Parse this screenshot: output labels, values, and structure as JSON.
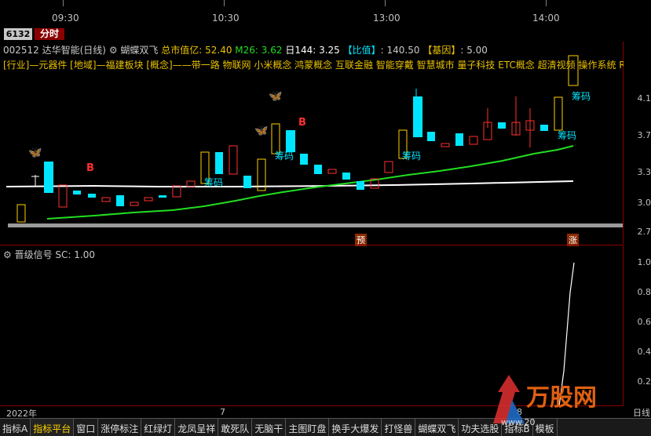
{
  "time_axis": {
    "labels": [
      "09:30",
      "10:30",
      "13:00",
      "14:00"
    ]
  },
  "toolbar": {
    "code_tag": "6132",
    "tab_label": "分时"
  },
  "header": {
    "stock_line": "002512 达华智能(日线)",
    "indicator_name": "蝴蝶双飞",
    "market_cap": "总市值亿: 52.40",
    "m26": "M26: 3.62",
    "d144": "日144: 3.25",
    "ratio_label": "【比值】",
    "ratio_value": ": 140.50",
    "gene_label": "【基因】",
    "gene_value": ": 5.00"
  },
  "concepts": "[行业]—元器件 [地域]—福建板块 [概念]——带一路 物联网 小米概念 鸿蒙概念 互联金融 智能穿戴 智慧城市 量子科技 ETC概念 超清视频 操作系统 RCS",
  "price_axis": [
    "4.1",
    "3.7",
    "3.3",
    "3.0",
    "2.7"
  ],
  "low_label": "",
  "signals": {
    "b1": "B",
    "b2": "B",
    "chip1": "筹码",
    "chip2": "筹码",
    "chip3": "筹码",
    "chip4": "筹码",
    "chip5": "筹码",
    "tag_yu": "预",
    "tag_zhang": "涨"
  },
  "sub_panel": {
    "title": "晋级信号",
    "sc": "SC: 1.00",
    "axis": [
      "1.0",
      "0.8",
      "0.6",
      "0.4",
      "0.2"
    ]
  },
  "bottom_axis": {
    "year": "2022年",
    "m7": "7",
    "m8": "8"
  },
  "tabs": [
    "指标A",
    "指标平台",
    "窗口",
    "涨停标注",
    "红绿灯",
    "龙凤呈祥",
    "敢死队",
    "无脑干",
    "主图盯盘",
    "换手大爆发",
    "打怪兽",
    "蝴蝶双飞",
    "功夫选股",
    "指标B",
    "模板"
  ],
  "right_corner": "日线",
  "watermark": {
    "brand": "万股网",
    "url": "www.20"
  },
  "colors": {
    "up": "#ffd100",
    "down": "#00e5ff",
    "ma_green": "#22dd22",
    "ma_white": "#ffffff",
    "signal_red": "#ff3030",
    "frame": "#8a0000"
  }
}
